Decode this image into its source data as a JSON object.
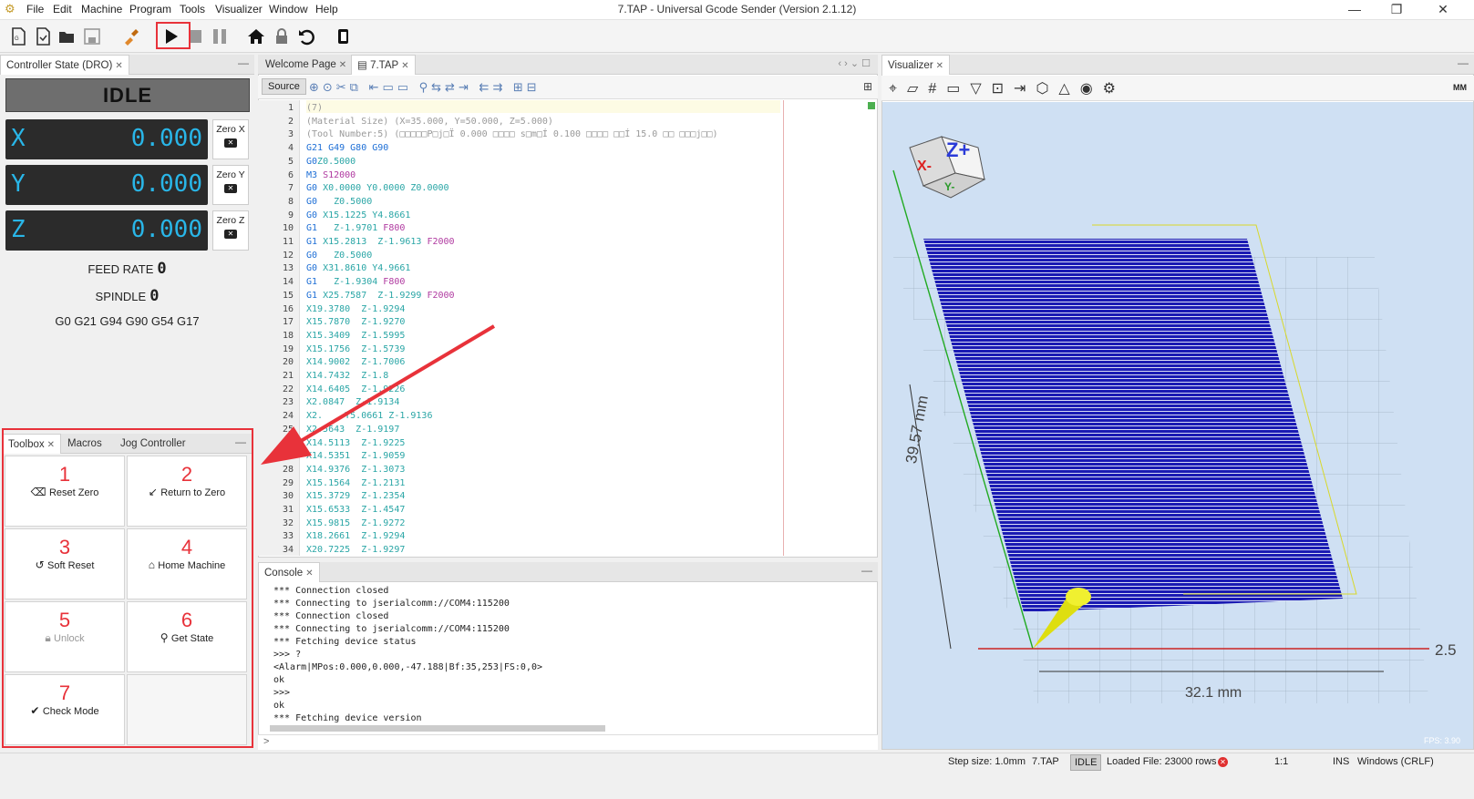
{
  "window": {
    "title": "7.TAP - Universal Gcode Sender (Version 2.1.12)",
    "app_icon": "ugs-logo-icon"
  },
  "menu": [
    "File",
    "Edit",
    "Machine",
    "Program",
    "Tools",
    "Visualizer",
    "Window",
    "Help"
  ],
  "dro": {
    "tab_label": "Controller State (DRO)",
    "state": "IDLE",
    "axes": [
      {
        "name": "X",
        "value": "0.000",
        "zero_label": "Zero X"
      },
      {
        "name": "Y",
        "value": "0.000",
        "zero_label": "Zero Y"
      },
      {
        "name": "Z",
        "value": "0.000",
        "zero_label": "Zero Z"
      }
    ],
    "feed_rate_label": "FEED RATE",
    "feed_rate_value": "0",
    "spindle_label": "SPINDLE",
    "spindle_value": "0",
    "gcode_state": "G0 G21 G94 G90 G54 G17"
  },
  "toolbox": {
    "tabs": [
      "Toolbox",
      "Macros",
      "Jog Controller"
    ],
    "buttons": [
      {
        "num": "1",
        "label": "Reset Zero",
        "icon": "eraser-icon"
      },
      {
        "num": "2",
        "label": "Return to Zero",
        "icon": "return-zero-icon"
      },
      {
        "num": "3",
        "label": "Soft Reset",
        "icon": "undo-icon"
      },
      {
        "num": "4",
        "label": "Home Machine",
        "icon": "home-icon"
      },
      {
        "num": "5",
        "label": "Unlock",
        "icon": "lock-icon"
      },
      {
        "num": "6",
        "label": "Get State",
        "icon": "search-icon"
      },
      {
        "num": "7",
        "label": "Check Mode",
        "icon": "check-icon"
      }
    ]
  },
  "editor": {
    "tabs": [
      "Welcome Page",
      "7.TAP"
    ],
    "source_label": "Source",
    "lines": [
      {
        "n": "1",
        "parts": [
          {
            "t": "(7)",
            "c": "comment"
          }
        ]
      },
      {
        "n": "2",
        "parts": [
          {
            "t": "(Material Size) (X=35.000, Y=50.000, Z=5.000)",
            "c": "comment"
          }
        ]
      },
      {
        "n": "3",
        "parts": [
          {
            "t": "(Tool Number:5) (□□□□□P□j□Ï 0.000 □□□□ s□m□Í 0.100 □□□□ □□Í 15.0 □□ □□□j□□)",
            "c": "comment"
          }
        ]
      },
      {
        "n": "4",
        "parts": [
          {
            "t": "G21 G49 G80 G90",
            "c": "g"
          }
        ]
      },
      {
        "n": "5",
        "parts": [
          {
            "t": "G0",
            "c": "g"
          },
          {
            "t": "Z0.5000",
            "c": "coord"
          }
        ]
      },
      {
        "n": "6",
        "parts": [
          {
            "t": "M3 ",
            "c": "m"
          },
          {
            "t": "S12000",
            "c": "feed"
          }
        ]
      },
      {
        "n": "7",
        "parts": [
          {
            "t": "G0 ",
            "c": "g"
          },
          {
            "t": "X0.0000 Y0.0000 Z0.0000",
            "c": "coord"
          }
        ]
      },
      {
        "n": "8",
        "parts": [
          {
            "t": "G0   ",
            "c": "g"
          },
          {
            "t": "Z0.5000",
            "c": "coord"
          }
        ]
      },
      {
        "n": "9",
        "parts": [
          {
            "t": "G0 ",
            "c": "g"
          },
          {
            "t": "X15.1225 Y4.8661",
            "c": "coord"
          }
        ]
      },
      {
        "n": "10",
        "parts": [
          {
            "t": "G1   ",
            "c": "g"
          },
          {
            "t": "Z-1.9701 ",
            "c": "coord"
          },
          {
            "t": "F800",
            "c": "feed"
          }
        ]
      },
      {
        "n": "11",
        "parts": [
          {
            "t": "G1 ",
            "c": "g"
          },
          {
            "t": "X15.2813  Z-1.9613 ",
            "c": "coord"
          },
          {
            "t": "F2000",
            "c": "feed"
          }
        ]
      },
      {
        "n": "12",
        "parts": [
          {
            "t": "G0   ",
            "c": "g"
          },
          {
            "t": "Z0.5000",
            "c": "coord"
          }
        ]
      },
      {
        "n": "13",
        "parts": [
          {
            "t": "G0 ",
            "c": "g"
          },
          {
            "t": "X31.8610 Y4.9661",
            "c": "coord"
          }
        ]
      },
      {
        "n": "14",
        "parts": [
          {
            "t": "G1   ",
            "c": "g"
          },
          {
            "t": "Z-1.9304 ",
            "c": "coord"
          },
          {
            "t": "F800",
            "c": "feed"
          }
        ]
      },
      {
        "n": "15",
        "parts": [
          {
            "t": "G1 ",
            "c": "g"
          },
          {
            "t": "X25.7587  Z-1.9299 ",
            "c": "coord"
          },
          {
            "t": "F2000",
            "c": "feed"
          }
        ]
      },
      {
        "n": "16",
        "parts": [
          {
            "t": "X19.3780  Z-1.9294",
            "c": "coord"
          }
        ]
      },
      {
        "n": "17",
        "parts": [
          {
            "t": "X15.7870  Z-1.9270",
            "c": "coord"
          }
        ]
      },
      {
        "n": "18",
        "parts": [
          {
            "t": "X15.3409  Z-1.5995",
            "c": "coord"
          }
        ]
      },
      {
        "n": "19",
        "parts": [
          {
            "t": "X15.1756  Z-1.5739",
            "c": "coord"
          }
        ]
      },
      {
        "n": "20",
        "parts": [
          {
            "t": "X14.9002  Z-1.7006",
            "c": "coord"
          }
        ]
      },
      {
        "n": "21",
        "parts": [
          {
            "t": "X14.7432  Z-1.8",
            "c": "coord"
          }
        ]
      },
      {
        "n": "22",
        "parts": [
          {
            "t": "X14.6405  Z-1.9226",
            "c": "coord"
          }
        ]
      },
      {
        "n": "23",
        "parts": [
          {
            "t": "X2.0847  Z-1.9134",
            "c": "coord"
          }
        ]
      },
      {
        "n": "24",
        "parts": [
          {
            "t": "X2.    Y5.0661 Z-1.9136",
            "c": "coord"
          }
        ]
      },
      {
        "n": "25",
        "parts": [
          {
            "t": "X2.5643  Z-1.9197",
            "c": "coord"
          }
        ]
      },
      {
        "n": "26",
        "parts": [
          {
            "t": "X14.5113  Z-1.9225",
            "c": "coord"
          }
        ]
      },
      {
        "n": "27",
        "parts": [
          {
            "t": "X14.5351  Z-1.9059",
            "c": "coord"
          }
        ]
      },
      {
        "n": "28",
        "parts": [
          {
            "t": "X14.9376  Z-1.3073",
            "c": "coord"
          }
        ]
      },
      {
        "n": "29",
        "parts": [
          {
            "t": "X15.1564  Z-1.2131",
            "c": "coord"
          }
        ]
      },
      {
        "n": "30",
        "parts": [
          {
            "t": "X15.3729  Z-1.2354",
            "c": "coord"
          }
        ]
      },
      {
        "n": "31",
        "parts": [
          {
            "t": "X15.6533  Z-1.4547",
            "c": "coord"
          }
        ]
      },
      {
        "n": "32",
        "parts": [
          {
            "t": "X15.9815  Z-1.9272",
            "c": "coord"
          }
        ]
      },
      {
        "n": "33",
        "parts": [
          {
            "t": "X18.2661  Z-1.9294",
            "c": "coord"
          }
        ]
      },
      {
        "n": "34",
        "parts": [
          {
            "t": "X20.7225  Z-1.9297",
            "c": "coord"
          }
        ]
      }
    ]
  },
  "console": {
    "tab_label": "Console",
    "lines": [
      "*** Connection closed",
      "*** Connecting to jserialcomm://COM4:115200",
      "*** Connection closed",
      "*** Connecting to jserialcomm://COM4:115200",
      "*** Fetching device status",
      ">>> ?",
      "<Alarm|MPos:0.000,0.000,-47.188|Bf:35,253|FS:0,0>",
      "ok",
      ">>>",
      "ok",
      "*** Fetching device version"
    ],
    "prompt": ">"
  },
  "visualizer": {
    "tab_label": "Visualizer",
    "units_label": "MM",
    "dim_y": "39.57 mm",
    "dim_x": "32.1 mm",
    "dim_z": "2.5",
    "fps_label": "FPS: 3.90",
    "cube_labels": {
      "x": "X-",
      "z": "Z+",
      "y": "Y-"
    }
  },
  "status": {
    "step_size": "Step size: 1.0mm",
    "file": "7.TAP",
    "state": "IDLE",
    "loaded_file": "Loaded File: 23000 rows",
    "ratio": "1:1",
    "ins": "INS",
    "eol": "Windows (CRLF)"
  },
  "colors": {
    "accent_red": "#e8323a",
    "dro_blue": "#29b6e8",
    "toolpath": "#1a1ab3"
  }
}
